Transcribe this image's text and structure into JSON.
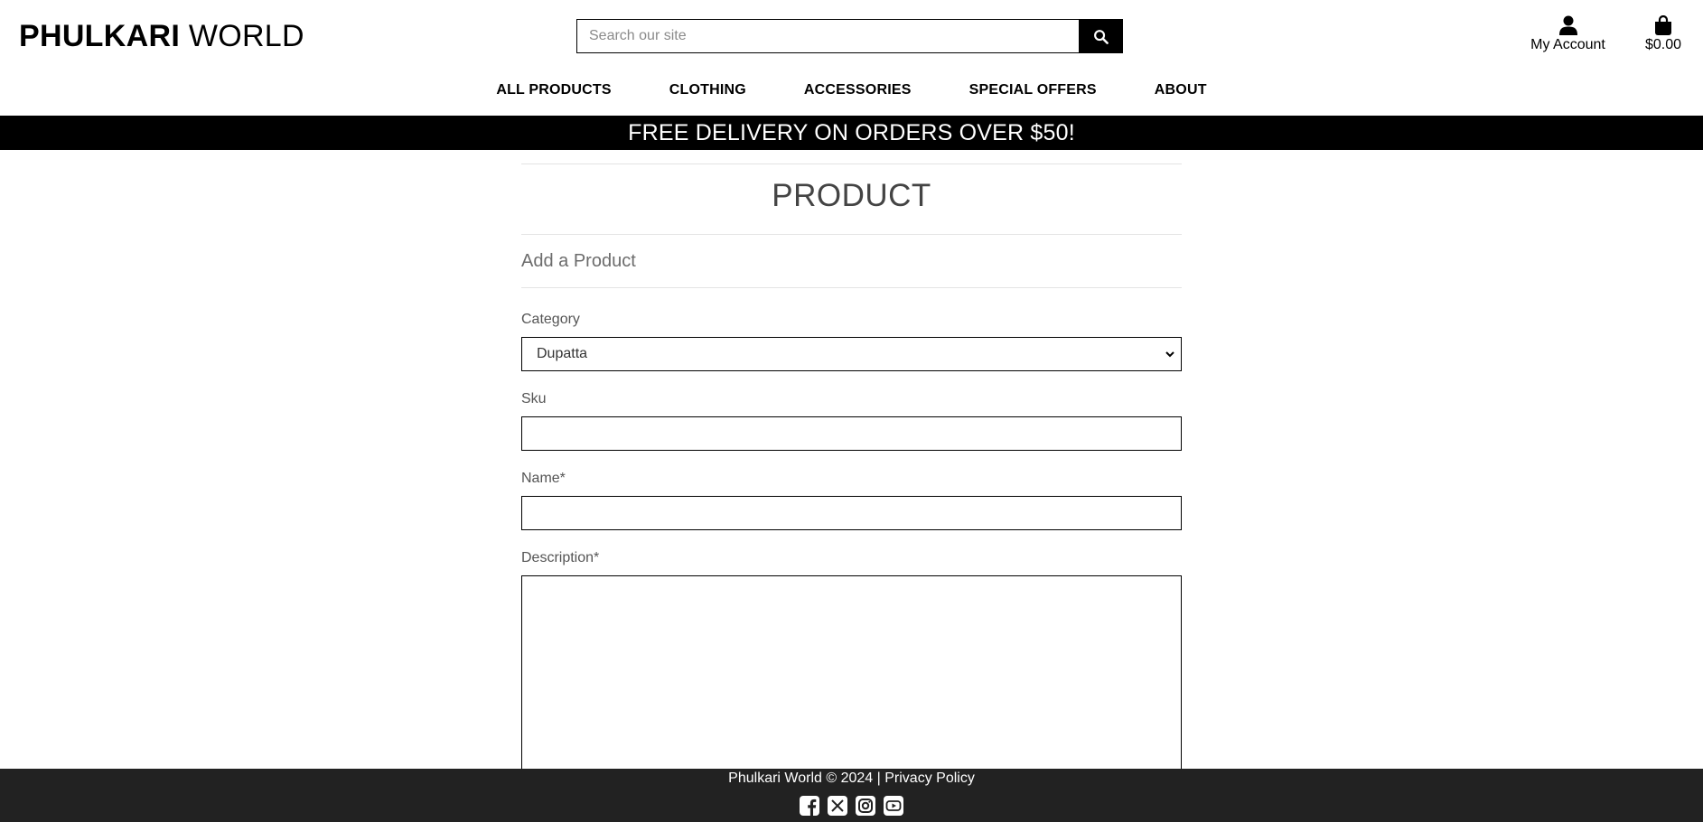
{
  "brand": {
    "strong": "PHULKARI",
    "light": "WORLD"
  },
  "search": {
    "placeholder": "Search our site",
    "value": ""
  },
  "account": {
    "label": "My Account",
    "icon": "user-icon"
  },
  "cart": {
    "amount": "$0.00",
    "icon": "shopping-bag-icon"
  },
  "nav": {
    "items": [
      {
        "label": "ALL PRODUCTS"
      },
      {
        "label": "CLOTHING"
      },
      {
        "label": "ACCESSORIES"
      },
      {
        "label": "SPECIAL OFFERS"
      },
      {
        "label": "ABOUT"
      }
    ]
  },
  "banner": {
    "text": "FREE DELIVERY ON ORDERS OVER $50!"
  },
  "page": {
    "title": "PRODUCT",
    "section_title": "Add a Product"
  },
  "form": {
    "category": {
      "label": "Category",
      "value": "Dupatta"
    },
    "sku": {
      "label": "Sku",
      "value": ""
    },
    "name": {
      "label": "Name*",
      "value": ""
    },
    "description": {
      "label": "Description*",
      "value": ""
    }
  },
  "footer": {
    "copyright": "Phulkari World © 2024 |",
    "privacy_link": "Privacy Policy",
    "socials": [
      "facebook-icon",
      "x-twitter-icon",
      "instagram-icon",
      "youtube-icon"
    ]
  },
  "colors": {
    "banner_bg": "#000000",
    "footer_bg": "#222222",
    "accent": "#000000"
  }
}
